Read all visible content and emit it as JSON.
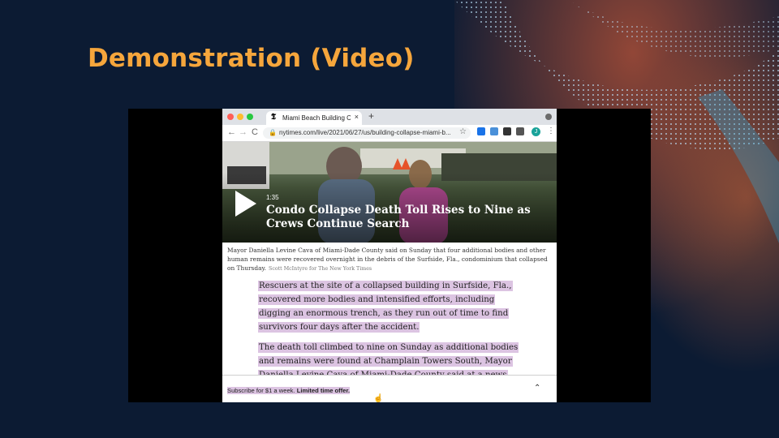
{
  "slide": {
    "title": "Demonstration (Video)"
  },
  "browser": {
    "tab_title": "Miami Beach Building Collapse",
    "tab_close": "×",
    "new_tab": "+",
    "url": "nytimes.com/live/2021/06/27/us/building-collapse-miami-b...",
    "back": "←",
    "forward": "→",
    "reload": "C",
    "star": "☆",
    "avatar": "J",
    "menu": "⋮",
    "colors": {
      "close": "#ff5f57",
      "minimize": "#febc2e",
      "maximize": "#28c840"
    }
  },
  "video": {
    "duration": "1:35",
    "headline": "Condo Collapse Death Toll Rises to Nine as Crews Continue Search"
  },
  "caption": {
    "text": "Mayor Daniella Levine Cava of Miami-Dade County said on Sunday that four additional bodies and other human remains were recovered overnight in the debris of the Surfside, Fla., condominium that collapsed on Thursday.",
    "credit": "Scott McIntyre for The New York Times"
  },
  "article": {
    "paragraphs": [
      "Rescuers at the site of a collapsed building in Surfside, Fla., recovered more bodies and intensified efforts, including digging an enormous trench, as they run out of time to find survivors four days after the accident.",
      "The death toll climbed to nine on Sunday as additional bodies and remains were found at Champlain Towers South, Mayor Daniella Levine Cava of Miami-Dade County said at a news conference."
    ]
  },
  "subscribe": {
    "text": "Subscribe for $1 a week.",
    "offer": "Limited time offer.",
    "chevron": "⌃"
  }
}
